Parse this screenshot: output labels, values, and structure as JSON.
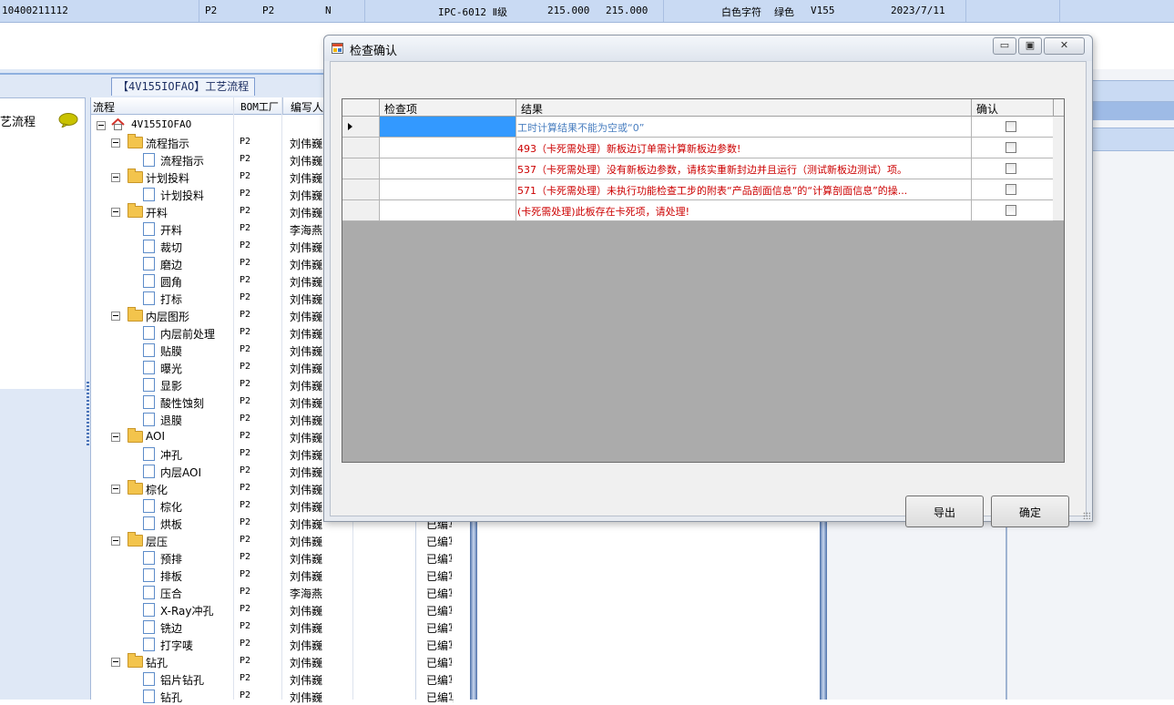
{
  "top_row": {
    "cells": [
      "10400211112",
      "P2",
      "P2",
      "N",
      "IPC-6012 Ⅱ级",
      "215.000",
      "215.000",
      "白色字符",
      "绿色",
      "V155",
      "2023/7/11"
    ]
  },
  "flow_caption": "【4V155IOFAO】工艺流程",
  "left_panel": {
    "title": "艺流程"
  },
  "tree_grid": {
    "headers": [
      "流程",
      "BOM工厂",
      "编写人"
    ],
    "root_label": "4V155IOFAO",
    "rows": [
      {
        "label": "流程指示",
        "factory": "P2",
        "writer": "刘伟巍",
        "status": ""
      },
      {
        "label": "流程指示",
        "factory": "P2",
        "writer": "刘伟巍",
        "status": ""
      },
      {
        "label": "计划投料",
        "factory": "P2",
        "writer": "刘伟巍",
        "status": ""
      },
      {
        "label": "计划投料",
        "factory": "P2",
        "writer": "刘伟巍",
        "status": ""
      },
      {
        "label": "开料",
        "factory": "P2",
        "writer": "刘伟巍",
        "status": ""
      },
      {
        "label": "开料",
        "factory": "P2",
        "writer": "李海燕",
        "status": ""
      },
      {
        "label": "裁切",
        "factory": "P2",
        "writer": "刘伟巍",
        "status": ""
      },
      {
        "label": "磨边",
        "factory": "P2",
        "writer": "刘伟巍",
        "status": ""
      },
      {
        "label": "圆角",
        "factory": "P2",
        "writer": "刘伟巍",
        "status": ""
      },
      {
        "label": "打标",
        "factory": "P2",
        "writer": "刘伟巍",
        "status": ""
      },
      {
        "label": "内层图形",
        "factory": "P2",
        "writer": "刘伟巍",
        "status": ""
      },
      {
        "label": "内层前处理",
        "factory": "P2",
        "writer": "刘伟巍",
        "status": ""
      },
      {
        "label": "贴膜",
        "factory": "P2",
        "writer": "刘伟巍",
        "status": ""
      },
      {
        "label": "曝光",
        "factory": "P2",
        "writer": "刘伟巍",
        "status": ""
      },
      {
        "label": "显影",
        "factory": "P2",
        "writer": "刘伟巍",
        "status": ""
      },
      {
        "label": "酸性蚀刻",
        "factory": "P2",
        "writer": "刘伟巍",
        "status": ""
      },
      {
        "label": "退膜",
        "factory": "P2",
        "writer": "刘伟巍",
        "status": ""
      },
      {
        "label": "AOI",
        "factory": "P2",
        "writer": "刘伟巍",
        "status": ""
      },
      {
        "label": "冲孔",
        "factory": "P2",
        "writer": "刘伟巍",
        "status": ""
      },
      {
        "label": "内层AOI",
        "factory": "P2",
        "writer": "刘伟巍",
        "status": ""
      },
      {
        "label": "棕化",
        "factory": "P2",
        "writer": "刘伟巍",
        "status": ""
      },
      {
        "label": "棕化",
        "factory": "P2",
        "writer": "刘伟巍",
        "status": ""
      },
      {
        "label": "烘板",
        "factory": "P2",
        "writer": "刘伟巍",
        "status": "已编写"
      },
      {
        "label": "层压",
        "factory": "P2",
        "writer": "刘伟巍",
        "status": "已编写"
      },
      {
        "label": "预排",
        "factory": "P2",
        "writer": "刘伟巍",
        "status": "已编写"
      },
      {
        "label": "排板",
        "factory": "P2",
        "writer": "刘伟巍",
        "status": "已编写"
      },
      {
        "label": "压合",
        "factory": "P2",
        "writer": "李海燕",
        "status": "已编写"
      },
      {
        "label": "X-Ray冲孔",
        "factory": "P2",
        "writer": "刘伟巍",
        "status": "已编写"
      },
      {
        "label": "铣边",
        "factory": "P2",
        "writer": "刘伟巍",
        "status": "已编写"
      },
      {
        "label": "打字唛",
        "factory": "P2",
        "writer": "刘伟巍",
        "status": "已编写"
      },
      {
        "label": "钻孔",
        "factory": "P2",
        "writer": "刘伟巍",
        "status": "已编写"
      },
      {
        "label": "铝片钻孔",
        "factory": "P2",
        "writer": "刘伟巍",
        "status": "已编写"
      },
      {
        "label": "钻孔",
        "factory": "P2",
        "writer": "刘伟巍",
        "status": "已编写"
      }
    ]
  },
  "dialog": {
    "title": "检查确认",
    "grid_headers": [
      "检查项",
      "结果",
      "确认"
    ],
    "rows": [
      {
        "item": "",
        "result": "工时计算结果不能为空或“0”",
        "color": "#4a7fc0",
        "checked": false
      },
      {
        "item": "",
        "result": "493（卡死需处理）新板边订单需计算新板边参数!",
        "color": "#cc0000",
        "checked": false
      },
      {
        "item": "",
        "result": "537（卡死需处理）没有新板边参数，请核实重新封边并且运行（测试新板边测试）项。",
        "color": "#cc0000",
        "checked": false
      },
      {
        "item": "",
        "result": "571（卡死需处理）未执行功能检查工步的附表“产品剖面信息”的“计算剖面信息”的操...",
        "color": "#cc0000",
        "checked": false
      },
      {
        "item": "",
        "result": "(卡死需处理)此板存在卡死项，请处理!",
        "color": "#cc0000",
        "checked": false
      }
    ],
    "buttons": {
      "export": "导出",
      "confirm": "确定"
    }
  },
  "colors": {
    "selection": "#3399ff",
    "error_text": "#cc0000",
    "info_text": "#4a7fc0"
  }
}
